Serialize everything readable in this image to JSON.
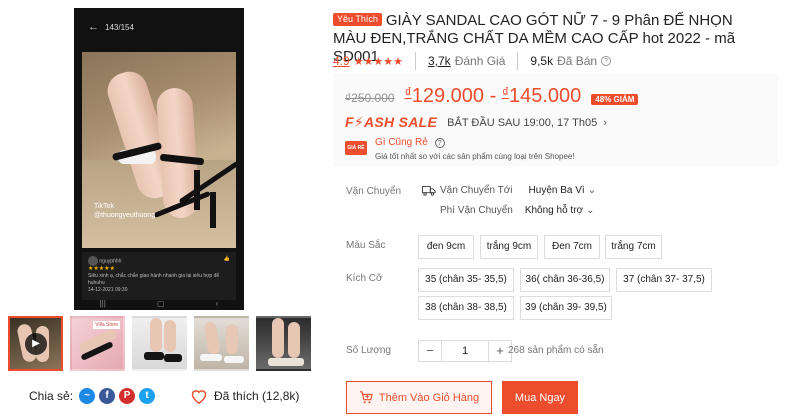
{
  "gallery": {
    "main": {
      "counter": "143/154",
      "app_label": "TikTok",
      "app_handle": "@thuongyeuthuong",
      "review_user": "nguyphhh",
      "review_stars": "★★★★★",
      "review_text": "Siêu xinh ạ, chắc chắn giao hành nhanh gia lại siêu hợp để huhuhu",
      "review_date": "14-12-2021 09:30"
    },
    "thumbs": [
      {
        "kind": "video",
        "icon": "play-icon"
      },
      {
        "kind": "image",
        "tag": "Villa Store"
      },
      {
        "kind": "image"
      },
      {
        "kind": "image"
      },
      {
        "kind": "image"
      }
    ],
    "share_label": "Chia sẻ:",
    "social": [
      {
        "name": "messenger",
        "glyph": "~",
        "color": "#1e88e5"
      },
      {
        "name": "facebook",
        "glyph": "f",
        "color": "#3b5998"
      },
      {
        "name": "pinterest",
        "glyph": "P",
        "color": "#d32f2f"
      },
      {
        "name": "twitter",
        "glyph": "t",
        "color": "#1da1f2"
      }
    ],
    "like_label": "Đã thích (12,8k)"
  },
  "product": {
    "badge": "Yêu Thích",
    "title": "GIÀY SANDAL CAO GÓT NỮ 7 - 9 Phân ĐẾ NHỌN MÀU ĐEN,TRẮNG CHẤT DA MỀM CAO CẤP hot 2022 - mã SD001",
    "rating": "4.9",
    "stars": "★★★★★",
    "reviews_count": "3,7k",
    "reviews_label": "Đánh Giá",
    "sold_count": "9,5k",
    "sold_label": "Đã Bán"
  },
  "price": {
    "original": "₫250.000",
    "currency": "₫",
    "range_low": "129.000",
    "dash": " - ",
    "range_high": "145.000",
    "discount": "48% GIẢM",
    "flash_logo": "F⚡ASH SALE",
    "flash_time": "BẮT ĐẦU SAU 19:00, 17 Th05",
    "cheap_icon_text": "GIÁ RẺ",
    "cheap_title": "Gì Cũng Rẻ",
    "cheap_sub": "Giá tốt nhất so với các sản phẩm cùng loại trên Shopee!"
  },
  "shipping": {
    "label": "Vận Chuyển",
    "to_label": "Vận Chuyển Tới",
    "to_value": "Huyện Ba Vì",
    "fee_label": "Phí Vận Chuyển",
    "fee_value": "Không hỗ trợ"
  },
  "colors": {
    "label": "Màu Sắc",
    "options": [
      "đen 9cm",
      "trắng 9cm",
      "Đen 7cm",
      "trắng 7cm"
    ]
  },
  "sizes": {
    "label": "Kích Cỡ",
    "options": [
      "35 (chân 35- 35,5)",
      "36( chân 36-36,5)",
      "37 (chân 37- 37,5)",
      "38 (chân 38- 38,5)",
      "39 (chân 39- 39,5)"
    ]
  },
  "quantity": {
    "label": "Số Lượng",
    "minus": "−",
    "value": "1",
    "plus": "+",
    "stock": "268 sản phẩm có sẵn"
  },
  "actions": {
    "add_to_cart": "Thêm Vào Giỏ Hàng",
    "buy_now": "Mua Ngay"
  },
  "theme": {
    "accent": "#ee4d2d",
    "accent_light": "#fff4f1"
  }
}
